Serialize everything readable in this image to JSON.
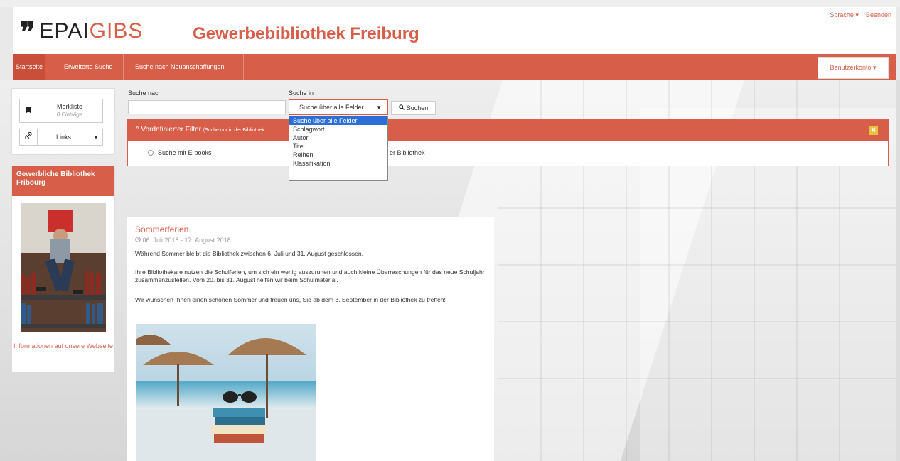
{
  "header": {
    "logo_mark": "❞",
    "logo_epai": "EPAI",
    "logo_gibs": "GIBS",
    "library_title": "Gewerbebibliothek Freiburg",
    "language_link": "Sprache ▾",
    "logout_link": "Beenden"
  },
  "nav": {
    "items": [
      {
        "label": "Startseite"
      },
      {
        "label": "Erweiterte Suche"
      },
      {
        "label": "Suche nach Neuanschaffungen"
      }
    ],
    "account_label": "Benutzerkonto ▾"
  },
  "sidebar": {
    "merkliste_label": "Merkliste",
    "merkliste_count": "0 Einträge",
    "links_label": "Links",
    "links_caret": "▾",
    "library_box_title": "Gewerbliche Bibliothek Fribourg",
    "info_link": "Informationen auf unsere Webseite"
  },
  "search": {
    "search_for_label": "Suche nach",
    "search_in_label": "Suche in",
    "query_value": "",
    "selected_field": "Suche über alle Felder",
    "select_arrow": "▼",
    "button_label": "Suchen",
    "field_options": [
      "Suche über alle Felder",
      "Schlagwort",
      "Autor",
      "Titel",
      "Reihen",
      "Klassifikation"
    ]
  },
  "filter": {
    "title": "Vordefinierter Filter",
    "subtitle": "(Suche nur in der Bibliothek",
    "close_glyph": "✖",
    "options": [
      {
        "label": "Suche mit E-books"
      },
      {
        "label": "er Bibliothek"
      }
    ]
  },
  "article": {
    "title": "Sommerferien",
    "date": "06. Juli 2018 - 17. August 2018",
    "p1": "Während Sommer bleibt die Bibliothek zwischen 6. Juli und 31. August geschlossen.",
    "p2": "Ihre Bibliothekare nutzen die Schulferien, um sich ein wenig auszuruhen und auch kleine Überraschungen für das neue Schuljahr zusammenzustellen. Vom 20. bis 31. August helfen wir beim Schulmaterial.",
    "p3": "Wir wünschen Ihnen einen schönen Sommer und freuen uns, Sie ab dem 3. September in der Bibliothek zu treffen!"
  },
  "colors": {
    "accent": "#d75f4a",
    "dropdown_selected": "#2b6fd6",
    "close_button": "#e8c23a"
  }
}
